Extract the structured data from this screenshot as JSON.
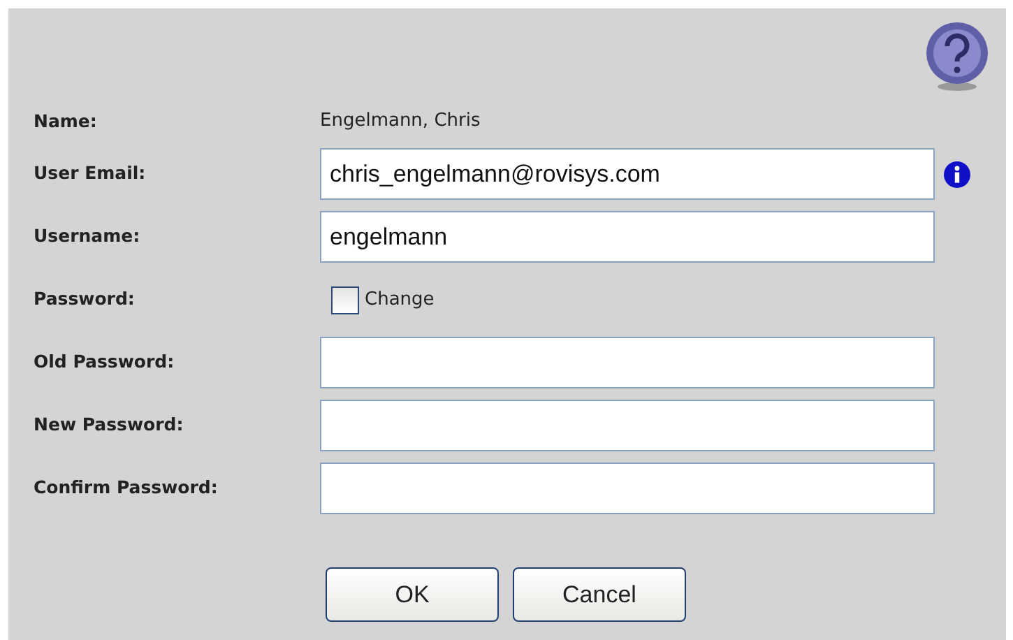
{
  "rows": [
    {
      "kind": "text",
      "label": "Name:",
      "value": "Engelmann, Chris"
    },
    {
      "kind": "input",
      "label": "User Email:",
      "value": "chris_engelmann@rovisys.com",
      "info": true
    },
    {
      "kind": "input",
      "label": "Username:",
      "value": "engelmann"
    },
    {
      "kind": "checkbox",
      "label": "Password:",
      "option": "Change",
      "checked": false
    },
    {
      "kind": "input",
      "label": "Old Password:",
      "value": ""
    },
    {
      "kind": "input",
      "label": "New Password:",
      "value": ""
    },
    {
      "kind": "input",
      "label": "Confirm Password:",
      "value": ""
    }
  ],
  "buttons": [
    "OK",
    "Cancel"
  ]
}
